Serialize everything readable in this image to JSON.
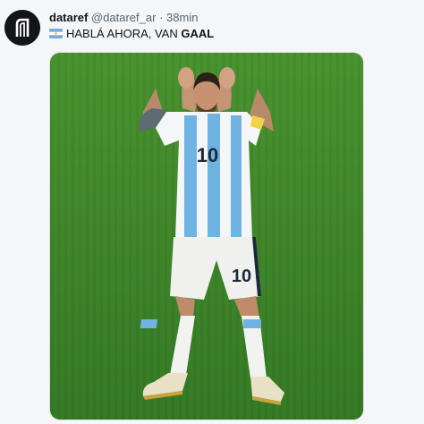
{
  "tweet": {
    "display_name": "dataref",
    "handle": "@dataref_ar",
    "separator": "·",
    "time": "38min",
    "text_prefix": "HABLÁ AHORA, VAN ",
    "text_bold": "GAAL"
  },
  "icons": {
    "flag": "argentina-flag-icon",
    "avatar": "dataref-logo-icon"
  },
  "media": {
    "jersey_number_shirt": "10",
    "jersey_number_shorts": "10"
  },
  "colors": {
    "name": "#0f1419",
    "meta": "#536471",
    "pitch": "#3f8a2c",
    "jersey_blue": "#6fb3e3"
  }
}
